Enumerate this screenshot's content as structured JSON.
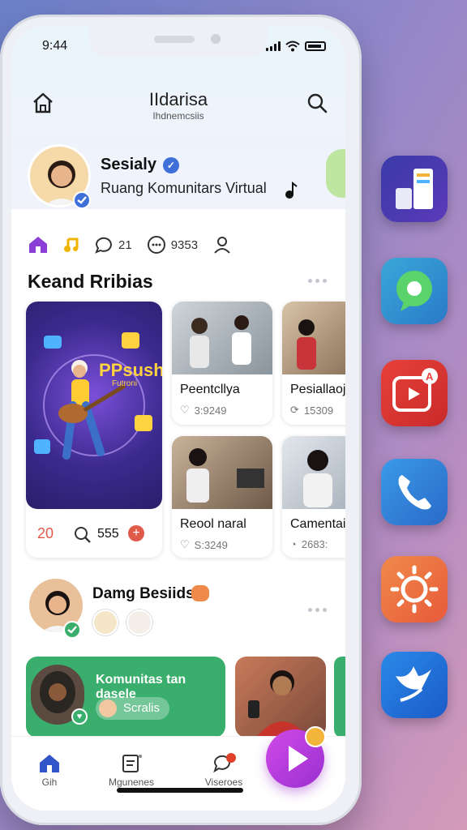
{
  "status": {
    "time": "9:44"
  },
  "header": {
    "title": "IIdarisa",
    "subtitle": "Ihdnemcsiis"
  },
  "profile": {
    "name": "Sesialy",
    "description": "Ruang Komunitars Virtual"
  },
  "actions": {
    "comments": "21",
    "messages": "9353"
  },
  "section1": {
    "title": "Keand Rribias",
    "feature": {
      "count_left": "20",
      "count_right": "555",
      "poster_text_1": "PPsush",
      "poster_text_2": "Futroni"
    },
    "cards": [
      {
        "title": "Peentcllya",
        "meta": "3:9249"
      },
      {
        "title": "Pesiallaoj",
        "meta": "15309"
      },
      {
        "title": "Reool naral",
        "meta": "S:3249"
      },
      {
        "title": "Camentai",
        "meta": "2683:"
      }
    ]
  },
  "section2": {
    "title": "Damg Besiids",
    "community": {
      "title": "Komunitas tan dasele",
      "button": "Scralis"
    }
  },
  "tabs": [
    {
      "label": "Gih"
    },
    {
      "label": "Mgunenes"
    },
    {
      "label": "Viseroes"
    }
  ],
  "colors": {
    "accent": "#3f6fd8",
    "green": "#3aae6c",
    "purple": "#b23fe0",
    "red": "#e05a4a"
  }
}
